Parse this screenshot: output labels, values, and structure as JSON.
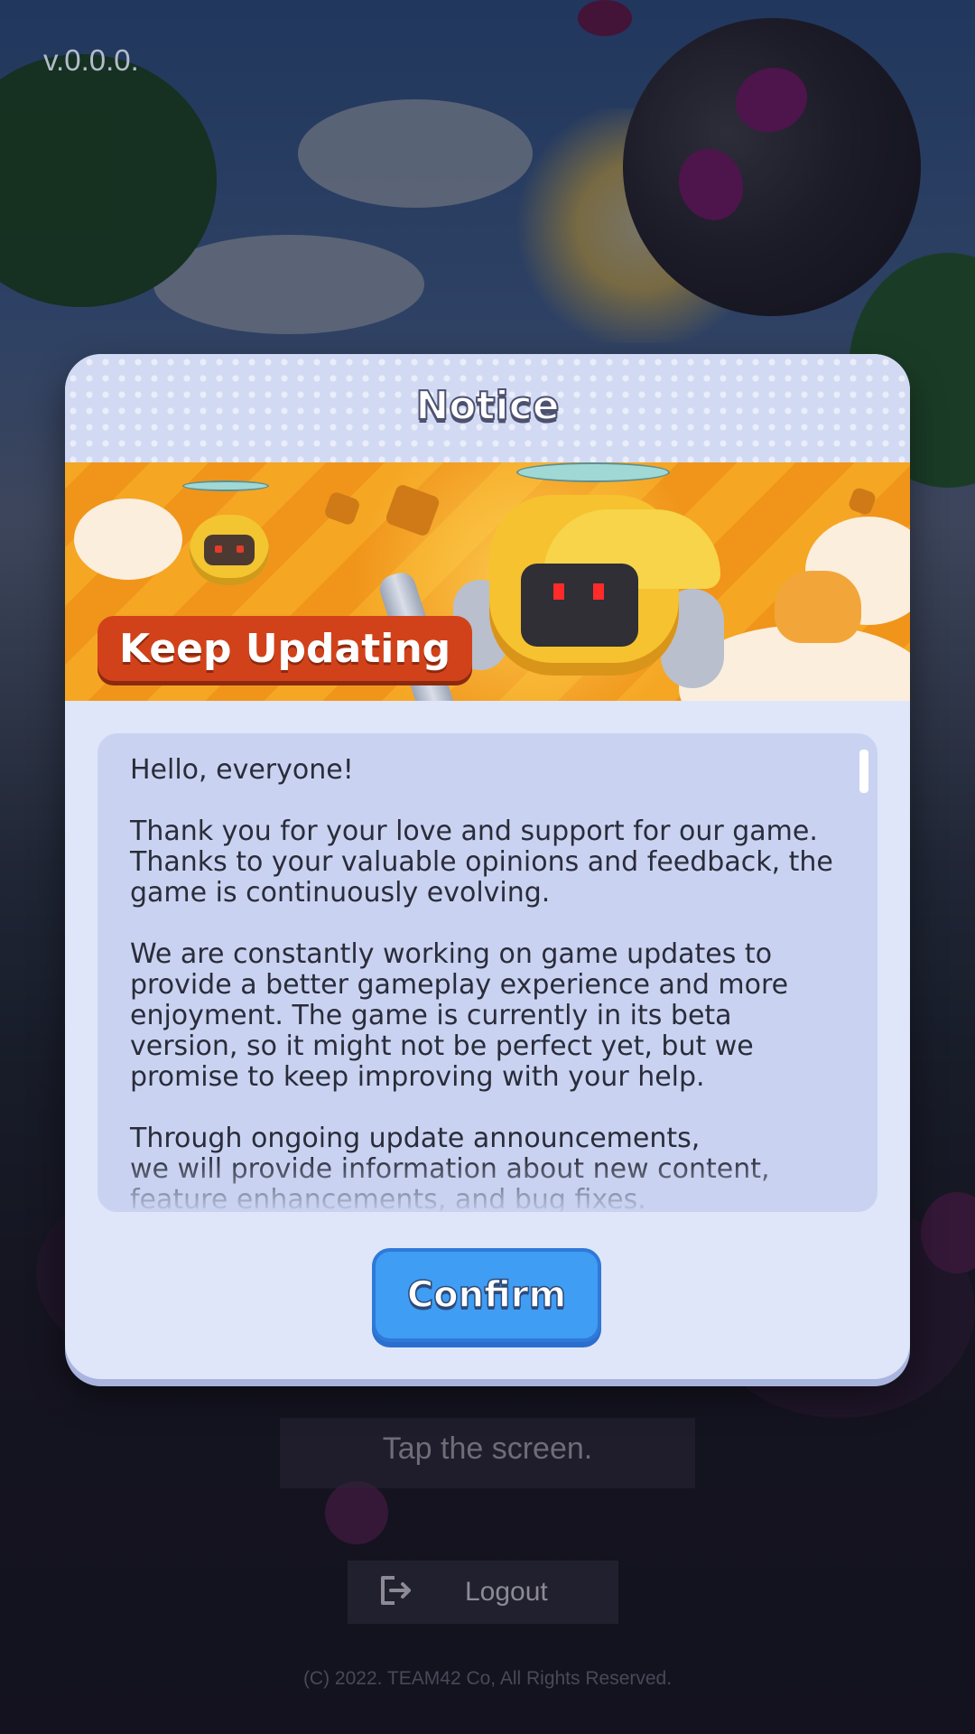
{
  "version": "v.0.0.0.",
  "tap_prompt": "Tap the screen.",
  "logout": {
    "label": "Logout",
    "icon": "logout-icon"
  },
  "copyright": "(C) 2022. TEAM42 Co, All Rights Reserved.",
  "dialog": {
    "title": "Notice",
    "banner_label": "Keep Updating",
    "paragraphs": [
      "Hello, everyone!",
      "Thank you for your love and support for our game.\nThanks to your valuable opinions and feedback, the game is continuously evolving.",
      "We are constantly working on game updates to provide a better gameplay experience and more enjoyment. The game is currently in its beta version, so it might not be perfect yet, but we promise to keep improving with your help.",
      "Through ongoing update announcements,\nwe will provide information about new content, feature enhancements, and bug fixes."
    ],
    "confirm_label": "Confirm"
  },
  "colors": {
    "dialog_bg": "#dfe6fa",
    "content_bg": "#c9d3f1",
    "confirm_button": "#3f9df3",
    "badge": "#d2421a",
    "banner_orange": "#f5a623"
  }
}
